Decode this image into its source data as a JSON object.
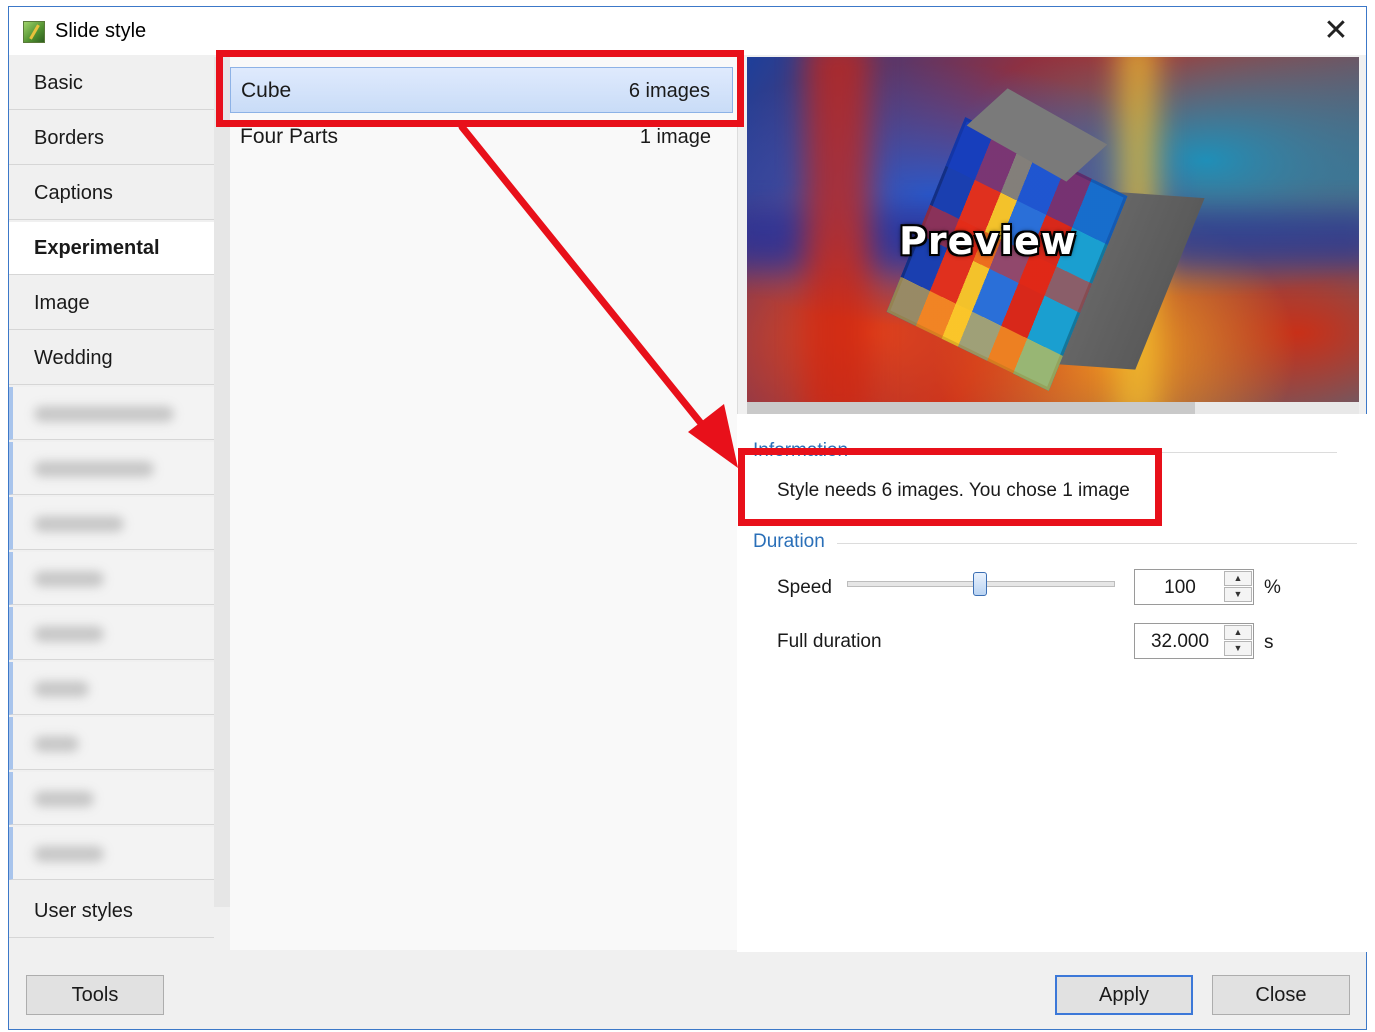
{
  "window": {
    "title": "Slide style"
  },
  "icons": {
    "app": "slide-style-app-icon",
    "close": "close-icon"
  },
  "categories": [
    {
      "label": "Basic",
      "active": false
    },
    {
      "label": "Borders",
      "active": false
    },
    {
      "label": "Captions",
      "active": false
    },
    {
      "label": "Experimental",
      "active": true
    },
    {
      "label": "Image",
      "active": false
    },
    {
      "label": "Wedding",
      "active": false
    }
  ],
  "user_styles_label": "User styles",
  "styles": [
    {
      "name": "Cube",
      "count": "6 images",
      "selected": true
    },
    {
      "name": "Four Parts",
      "count": "1 image",
      "selected": false
    }
  ],
  "preview": {
    "label": "Preview"
  },
  "information": {
    "heading": "Information",
    "message": "Style needs 6 images. You chose 1 image"
  },
  "duration": {
    "heading": "Duration",
    "speed_label": "Speed",
    "speed_value": "100",
    "speed_unit": "%",
    "full_duration_label": "Full duration",
    "full_duration_value": "32.000",
    "full_duration_unit": "s"
  },
  "buttons": {
    "tools": "Tools",
    "apply": "Apply",
    "close": "Close"
  },
  "colors": {
    "annotation": "#e8101a",
    "accent": "#2a6fb8",
    "selection": "#c9dcf7"
  }
}
